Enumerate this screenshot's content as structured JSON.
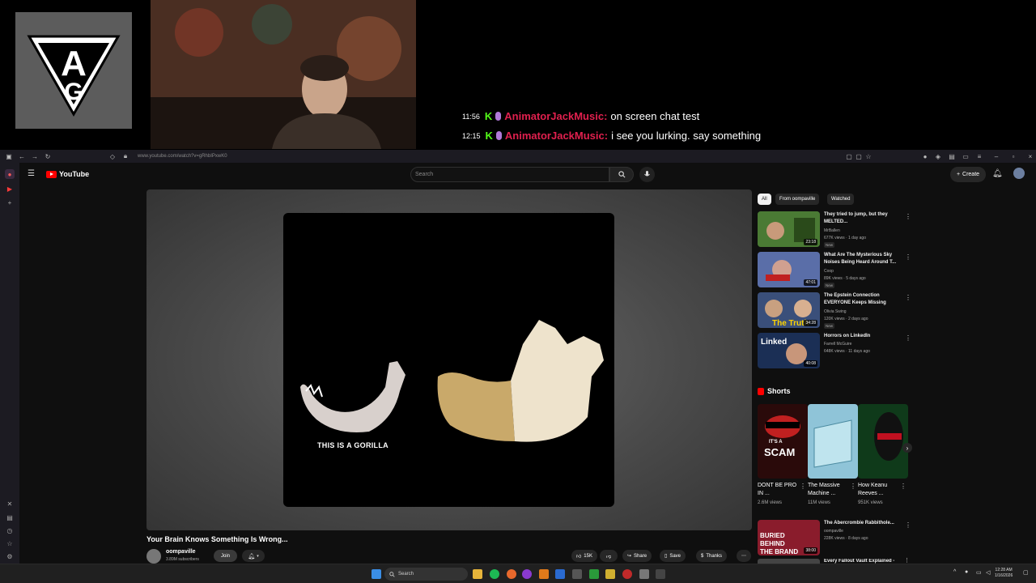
{
  "overlay": {
    "chat": [
      {
        "time": "11:56",
        "badge": "K",
        "user": "AnimatorJackMusic:",
        "message": "on screen chat test"
      },
      {
        "time": "12:15",
        "badge": "K",
        "user": "AnimatorJackMusic:",
        "message": "i see you lurking. say something"
      }
    ],
    "logo_letters": "AG"
  },
  "browser": {
    "url": "www.youtube.com/watch?v=gRhbIPxwK0"
  },
  "youtube": {
    "logo_text": "YouTube",
    "search_placeholder": "Search",
    "create_label": "Create",
    "video": {
      "caption": "THIS IS A GORILLA",
      "title": "Your Brain Knows Something Is Wrong...",
      "channel": "oompaville",
      "subscribers": "3.89M subscribers",
      "join_label": "Join",
      "likes": "15K",
      "share_label": "Share",
      "save_label": "Save",
      "thanks_label": "Thanks"
    },
    "chips": [
      "All",
      "From oompaville",
      "Watched"
    ],
    "recommendations": [
      {
        "title": "They tried to jump, but they MELTED...",
        "channel": "MrBallen",
        "meta": "677K views · 1 day ago",
        "badge": "New",
        "duration": "23:18",
        "color": "#3d6b2a"
      },
      {
        "title": "What Are The Mysterious Sky Noises Being Heard Around T...",
        "channel": "Coop",
        "meta": "89K views · 5 days ago",
        "badge": "New",
        "duration": "47:01",
        "color": "#5a6ea8"
      },
      {
        "title": "The Epstein Connection EVERYONE Keeps Missing",
        "channel": "Olivia Swing",
        "meta": "120K views · 2 days ago",
        "badge": "New",
        "duration": "34:28",
        "color": "#3a4f7a"
      },
      {
        "title": "Horrors on LinkedIn",
        "channel": "Farrell McGuire",
        "meta": "648K views · 11 days ago",
        "badge": "",
        "duration": "40:08",
        "color": "#1b2f55"
      },
      {
        "title": "The Abercrombie Rabbithole...",
        "channel": "oompaville",
        "meta": "228K views · 8 days ago",
        "badge": "",
        "duration": "38:00",
        "color": "#8a1c2c"
      },
      {
        "title": "Every Fallout Vault Explained -",
        "channel": "",
        "meta": "",
        "badge": "",
        "duration": "",
        "color": "#444"
      }
    ],
    "shorts_label": "Shorts",
    "shorts": [
      {
        "title": "DONT BE PRO IN ...",
        "views": "2.6M views",
        "overlay_text": "IT'S A SCAM",
        "color": "#2a0a0a"
      },
      {
        "title": "The Massive Machine ...",
        "views": "11M views",
        "overlay_text": "",
        "color": "#8fc4d8"
      },
      {
        "title": "How Keanu Reeves ...",
        "views": "951K views",
        "overlay_text": "",
        "color": "#0f3a1a"
      }
    ]
  },
  "taskbar": {
    "search_placeholder": "Search",
    "time": "12:28 AM",
    "date": "1/16/2026"
  }
}
